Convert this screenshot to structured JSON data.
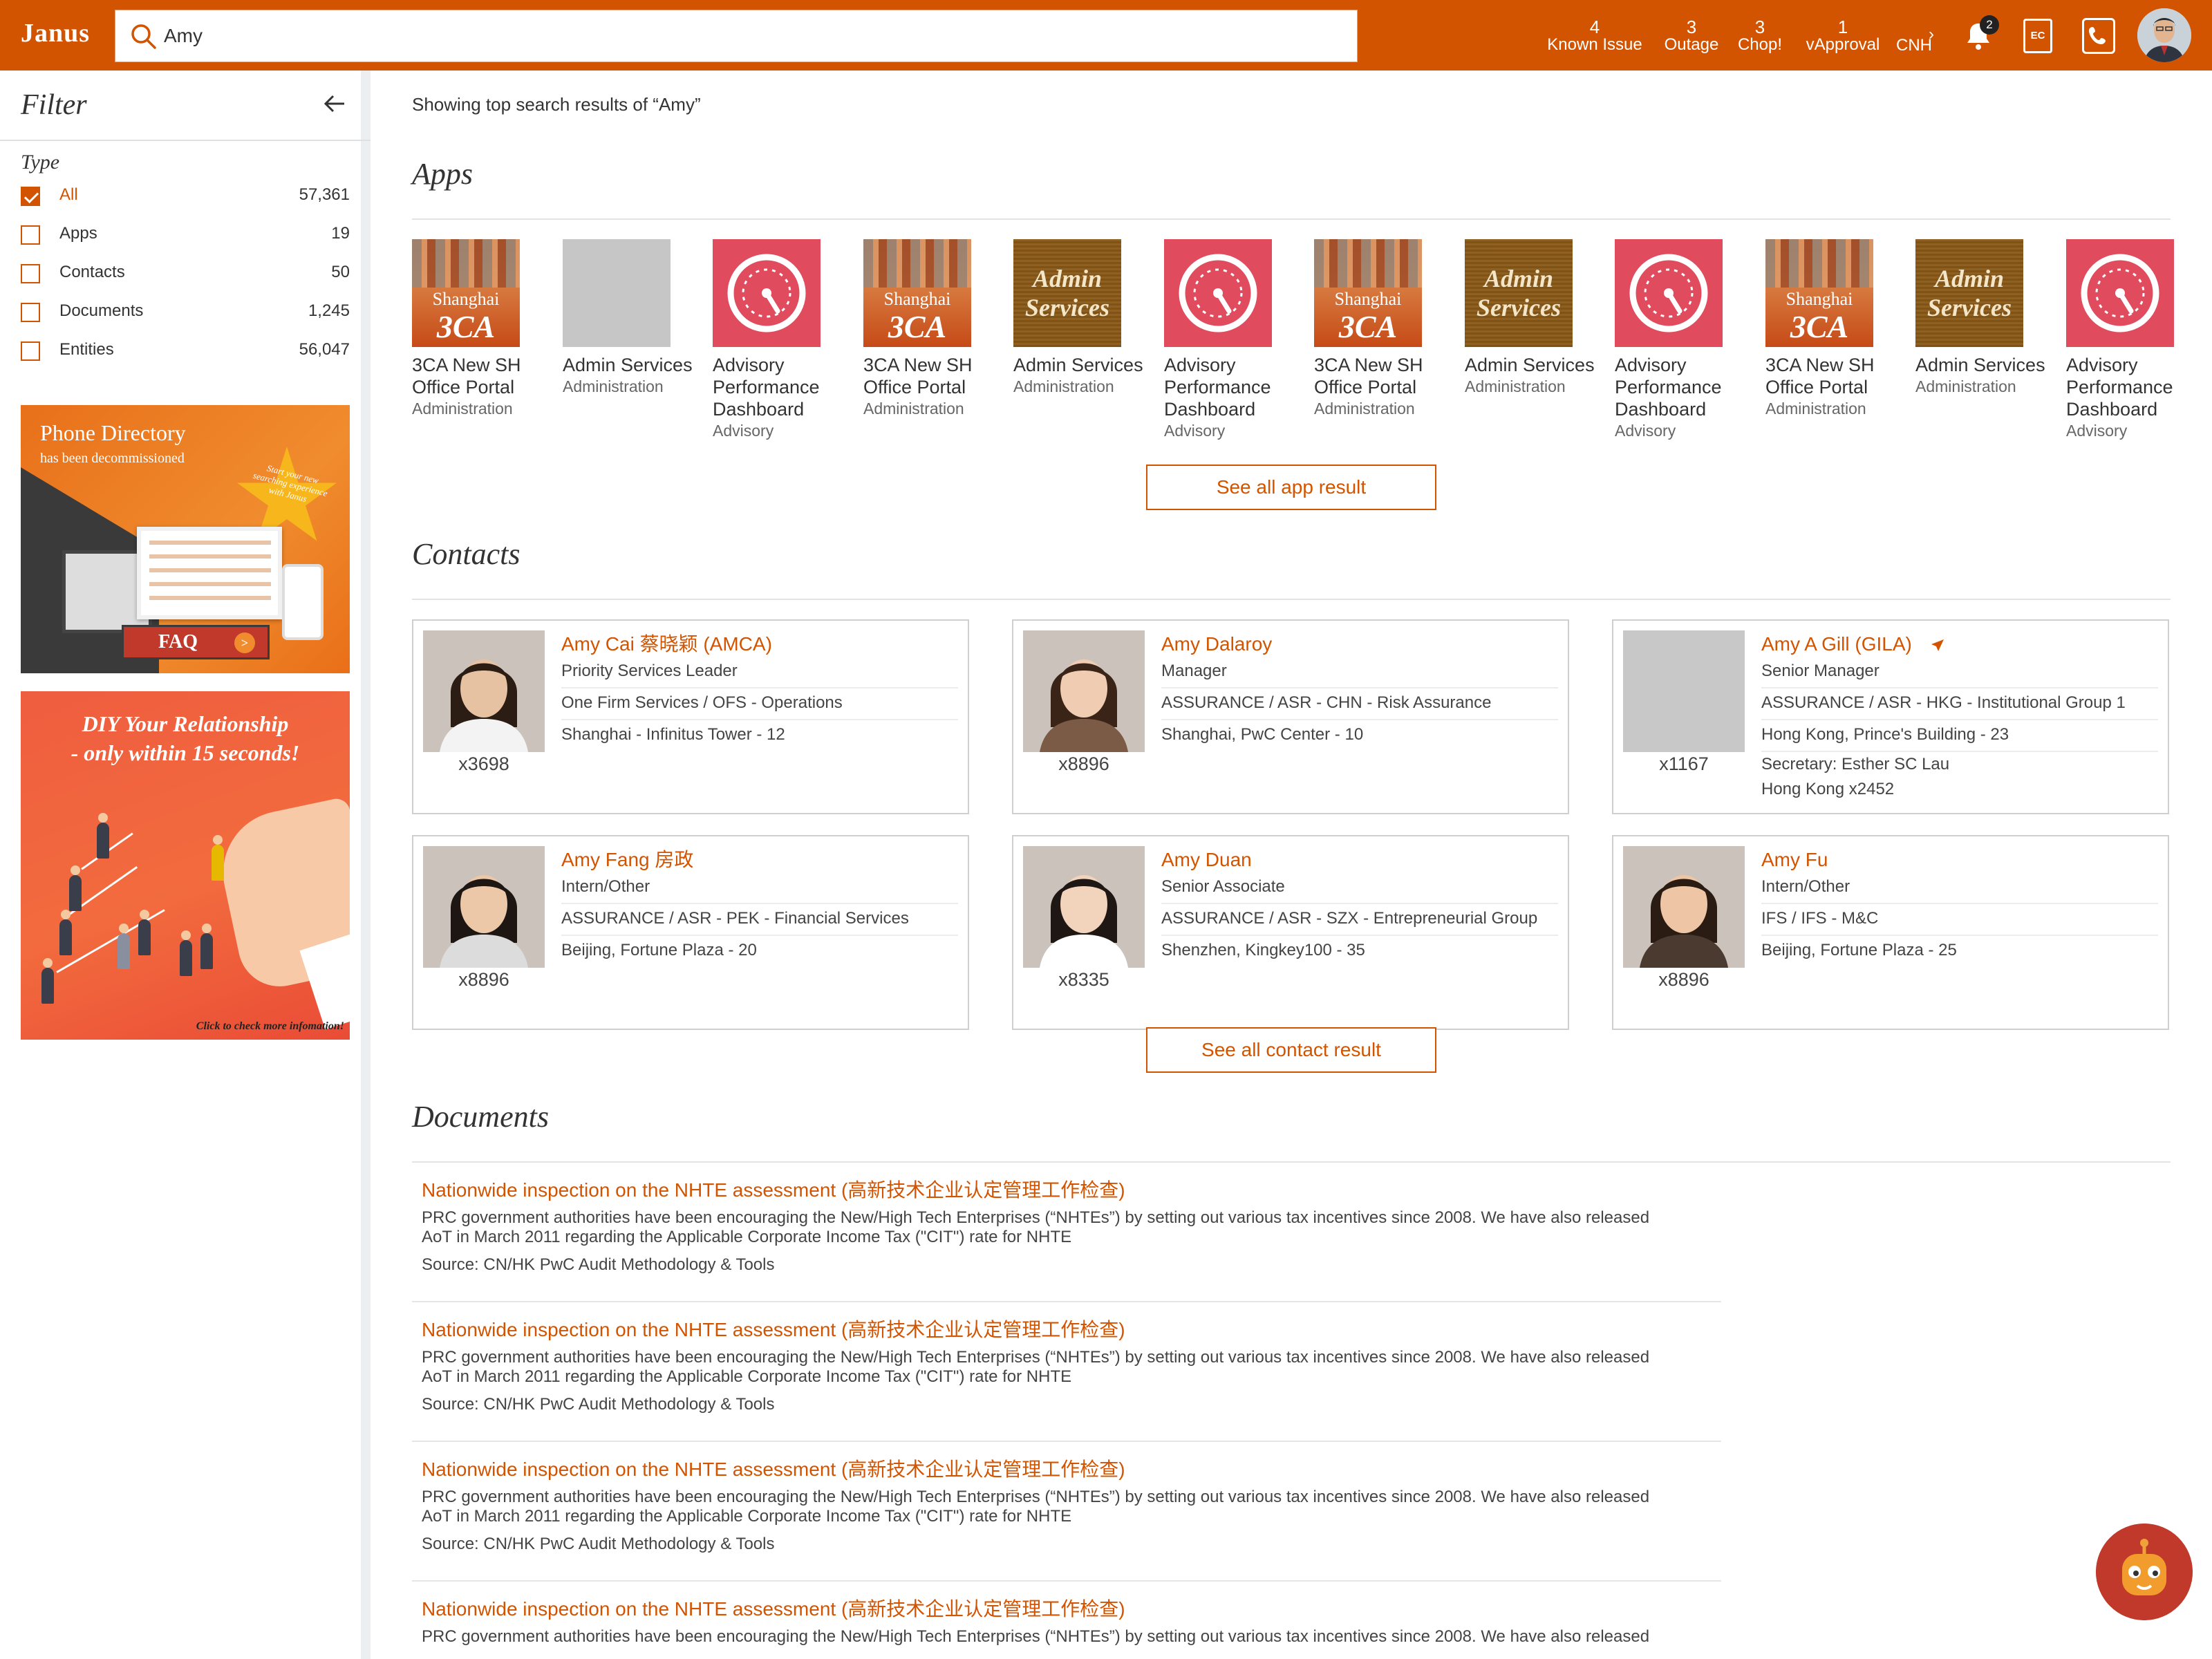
{
  "topbar": {
    "brand": "Janus",
    "search_value": "Amy",
    "counters": [
      {
        "count": "4",
        "label": "Known Issue"
      },
      {
        "count": "3",
        "label": "Outage"
      },
      {
        "count": "3",
        "label": "Chop!"
      },
      {
        "count": "1",
        "label": "vApproval"
      }
    ],
    "cnh_label": "CNH",
    "more_arrow": "›",
    "notification_badge": "2",
    "ec_label": "EC",
    "icons": [
      "search-icon",
      "chevron-right-icon",
      "bell-icon",
      "ec-icon",
      "phone-icon",
      "avatar"
    ]
  },
  "sidebar": {
    "title": "Filter",
    "type_label": "Type",
    "facets": [
      {
        "label": "All",
        "count": "57,361",
        "checked": true
      },
      {
        "label": "Apps",
        "count": "19",
        "checked": false
      },
      {
        "label": "Contacts",
        "count": "50",
        "checked": false
      },
      {
        "label": "Documents",
        "count": "1,245",
        "checked": false
      },
      {
        "label": "Entities",
        "count": "56,047",
        "checked": false
      }
    ],
    "banner_phone": {
      "title": "Phone Directory",
      "subtitle": "has been decommissioned",
      "star_text": "Start your new searching experience with Janus",
      "faq": "FAQ",
      "faq_arrow": ">"
    },
    "banner_diy": {
      "title_line1": "DIY Your Relationship",
      "title_line2": "- only within 15 seconds!",
      "footer": "Click to check more infomation!"
    }
  },
  "main": {
    "showing": "Showing top search results of “Amy”",
    "apps_title": "Apps",
    "apps": [
      {
        "style": "sh",
        "thumb_top": "Shanghai",
        "thumb_main": "3CA",
        "name": "3CA New SH Office Portal",
        "category": "Administration"
      },
      {
        "style": "blank",
        "thumb_top": "",
        "thumb_main": "",
        "name": "Admin Services",
        "category": "Administration"
      },
      {
        "style": "adv",
        "thumb_top": "",
        "thumb_main": "",
        "name": "Advisory Performance Dashboard",
        "category": "Advisory"
      },
      {
        "style": "sh",
        "thumb_top": "Shanghai",
        "thumb_main": "3CA",
        "name": "3CA New SH Office Portal",
        "category": "Administration"
      },
      {
        "style": "adm",
        "thumb_top": "Admin",
        "thumb_main": "Services",
        "name": "Admin Services",
        "category": "Administration"
      },
      {
        "style": "adv",
        "thumb_top": "",
        "thumb_main": "",
        "name": "Advisory Performance Dashboard",
        "category": "Advisory"
      },
      {
        "style": "sh",
        "thumb_top": "Shanghai",
        "thumb_main": "3CA",
        "name": "3CA New SH Office Portal",
        "category": "Administration"
      },
      {
        "style": "adm",
        "thumb_top": "Admin",
        "thumb_main": "Services",
        "name": "Admin Services",
        "category": "Administration"
      },
      {
        "style": "adv",
        "thumb_top": "",
        "thumb_main": "",
        "name": "Advisory Performance Dashboard",
        "category": "Advisory"
      },
      {
        "style": "sh",
        "thumb_top": "Shanghai",
        "thumb_main": "3CA",
        "name": "3CA New SH Office Portal",
        "category": "Administration"
      },
      {
        "style": "adm",
        "thumb_top": "Admin",
        "thumb_main": "Services",
        "name": "Admin Services",
        "category": "Administration"
      },
      {
        "style": "adv",
        "thumb_top": "",
        "thumb_main": "",
        "name": "Advisory Performance Dashboard",
        "category": "Advisory"
      }
    ],
    "see_all_apps": "See all app result",
    "contacts_title": "Contacts",
    "contacts": [
      {
        "name": "Amy Cai 蔡晓颖 (AMCA)",
        "title": "Priority Services Leader",
        "dept": "One Firm Services / OFS - Operations",
        "location": "Shanghai - Infinitus Tower - 12",
        "ext": "x3698",
        "photo": true,
        "travel": false,
        "extra": []
      },
      {
        "name": "Amy Dalaroy",
        "title": "Manager",
        "dept": "ASSURANCE / ASR - CHN - Risk Assurance",
        "location": "Shanghai, PwC Center - 10",
        "ext": "x8896",
        "photo": true,
        "travel": false,
        "extra": []
      },
      {
        "name": "Amy A Gill (GILA)",
        "title": "Senior Manager",
        "dept": "ASSURANCE / ASR - HKG - Institutional Group 1",
        "location": "Hong Kong, Prince's Building - 23",
        "ext": "x1167",
        "photo": false,
        "travel": true,
        "extra": [
          "Secretary: Esther SC Lau",
          "Hong Kong x2452"
        ]
      },
      {
        "name": "Amy Fang 房政",
        "title": "Intern/Other",
        "dept": "ASSURANCE / ASR - PEK - Financial Services",
        "location": "Beijing, Fortune Plaza - 20",
        "ext": "x8896",
        "photo": true,
        "travel": false,
        "extra": []
      },
      {
        "name": "Amy Duan",
        "title": "Senior Associate",
        "dept": "ASSURANCE / ASR - SZX - Entrepreneurial Group",
        "location": "Shenzhen, Kingkey100 - 35",
        "ext": "x8335",
        "photo": true,
        "travel": false,
        "extra": []
      },
      {
        "name": "Amy Fu",
        "title": "Intern/Other",
        "dept": "IFS / IFS - M&C",
        "location": "Beijing, Fortune Plaza - 25",
        "ext": "x8896",
        "photo": true,
        "travel": false,
        "extra": []
      }
    ],
    "see_all_contacts": "See all contact result",
    "documents_title": "Documents",
    "documents": [
      {
        "title": "Nationwide inspection on the NHTE assessment (高新技术企业认定管理工作检查)",
        "desc_line1": "PRC government authorities have been encouraging the New/High Tech Enterprises (“NHTEs”) by setting out various tax incentives since 2008. We have also released",
        "desc_line2": "AoT in March 2011 regarding the Applicable Corporate Income Tax (\"CIT\") rate for NHTE",
        "source": "Source: CN/HK PwC Audit Methodology & Tools"
      },
      {
        "title": "Nationwide inspection on the NHTE assessment (高新技术企业认定管理工作检查)",
        "desc_line1": "PRC government authorities have been encouraging the New/High Tech Enterprises (“NHTEs”) by setting out various tax incentives since 2008. We have also released",
        "desc_line2": "AoT in March 2011 regarding the Applicable Corporate Income Tax (\"CIT\") rate for NHTE",
        "source": "Source: CN/HK PwC Audit Methodology & Tools"
      },
      {
        "title": "Nationwide inspection on the NHTE assessment (高新技术企业认定管理工作检查)",
        "desc_line1": "PRC government authorities have been encouraging the New/High Tech Enterprises (“NHTEs”) by setting out various tax incentives since 2008. We have also released",
        "desc_line2": "AoT in March 2011 regarding the Applicable Corporate Income Tax (\"CIT\") rate for NHTE",
        "source": "Source: CN/HK PwC Audit Methodology & Tools"
      },
      {
        "title": "Nationwide inspection on the NHTE assessment (高新技术企业认定管理工作检查)",
        "desc_line1": "PRC government authorities have been encouraging the New/High Tech Enterprises (“NHTEs”) by setting out various tax incentives since 2008. We have also released",
        "desc_line2": "",
        "source": ""
      }
    ]
  },
  "colors": {
    "brand": "#d35400",
    "sidebar_divider": "#eceeef",
    "advisory": "#e04b5e",
    "admin": "#8a5a18"
  }
}
